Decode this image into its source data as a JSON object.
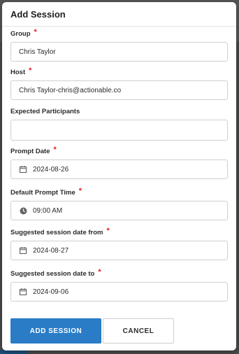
{
  "modal": {
    "title": "Add Session",
    "required_mark": "*",
    "fields": {
      "group": {
        "label": "Group",
        "value": "Chris Taylor"
      },
      "host": {
        "label": "Host",
        "value": "Chris Taylor-chris@actionable.co"
      },
      "expected_participants": {
        "label": "Expected Participants",
        "value": ""
      },
      "prompt_date": {
        "label": "Prompt Date",
        "value": "2024-08-26",
        "icon": "calendar-icon"
      },
      "default_prompt_time": {
        "label": "Default Prompt Time",
        "value": "09:00 AM",
        "icon": "clock-icon"
      },
      "suggested_from": {
        "label": "Suggested session date from",
        "value": "2024-08-27",
        "icon": "calendar-icon"
      },
      "suggested_to": {
        "label": "Suggested session date to",
        "value": "2024-09-06",
        "icon": "calendar-icon"
      }
    },
    "buttons": {
      "add": "ADD SESSION",
      "cancel": "CANCEL"
    }
  },
  "colors": {
    "primary": "#2a7cc7",
    "required": "#e02020"
  }
}
